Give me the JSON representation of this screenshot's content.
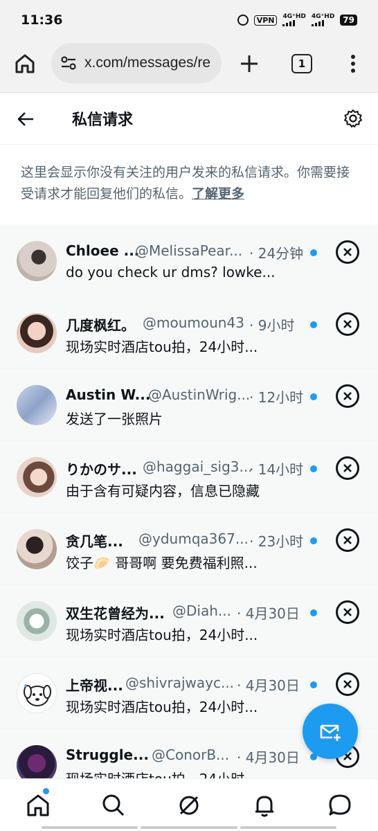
{
  "status_bar": {
    "time": "11:36",
    "vpn": "VPN",
    "network1": "4G⁺HD",
    "network2": "4G⁺HD",
    "battery": "79"
  },
  "browser": {
    "url": "x.com/messages/re",
    "tab_count": "1"
  },
  "header": {
    "title": "私信请求"
  },
  "notice": {
    "text": "这里会显示你没有关注的用户发来的私信请求。你需要接受请求才能回复他们的私信。",
    "link": "了解更多"
  },
  "requests": [
    {
      "name": "Chloee ...",
      "handle": "@MelissaPear...",
      "time": "· 24分钟",
      "message": "do you check ur dms? lowke...",
      "unread": true
    },
    {
      "name": "几度枫红。",
      "handle": "@moumoun43",
      "time": "· 9小时",
      "message": "现场实时酒店tou拍，24小时...",
      "unread": true
    },
    {
      "name": "Austin W...",
      "handle": "@AustinWrig...",
      "time": "· 12小时",
      "message": "发送了一张照片",
      "unread": true
    },
    {
      "name": "りかのサ...",
      "handle": "@haggai_sig3...",
      "time": "· 14小时",
      "message": "由于含有可疑内容，信息已隐藏",
      "unread": true
    },
    {
      "name": "贪几笔...",
      "handle": "@ydumqa367...",
      "time": "· 23小时",
      "message": "饺子🥟 哥哥啊 要免费福利照...",
      "unread": true
    },
    {
      "name": "双生花曾经为...",
      "handle": "@Diah...",
      "time": "· 4月30日",
      "message": "现场实时酒店tou拍，24小时...",
      "unread": true
    },
    {
      "name": "上帝视...",
      "handle": "@shivrajwayc...",
      "time": "· 4月30日",
      "message": "现场实时酒店tou拍，24小时...",
      "unread": true
    },
    {
      "name": "Struggle...",
      "handle": "@ConorB...",
      "time": "· 4月30日",
      "message": "现场实时酒店tou拍，24小时...",
      "unread": true
    }
  ],
  "colors": {
    "accent": "#1d9bf0",
    "text_primary": "#0f1419",
    "text_secondary": "#536471"
  },
  "icons": {
    "browser": [
      "home-icon",
      "tune-icon",
      "plus-icon",
      "tabs-icon",
      "more-vert-icon"
    ],
    "header": [
      "back-arrow-icon",
      "gear-icon"
    ],
    "row": [
      "close-circle-icon"
    ],
    "fab": "new-message-icon",
    "nav": [
      "home-icon",
      "search-icon",
      "grok-icon",
      "bell-icon",
      "messages-icon"
    ]
  }
}
